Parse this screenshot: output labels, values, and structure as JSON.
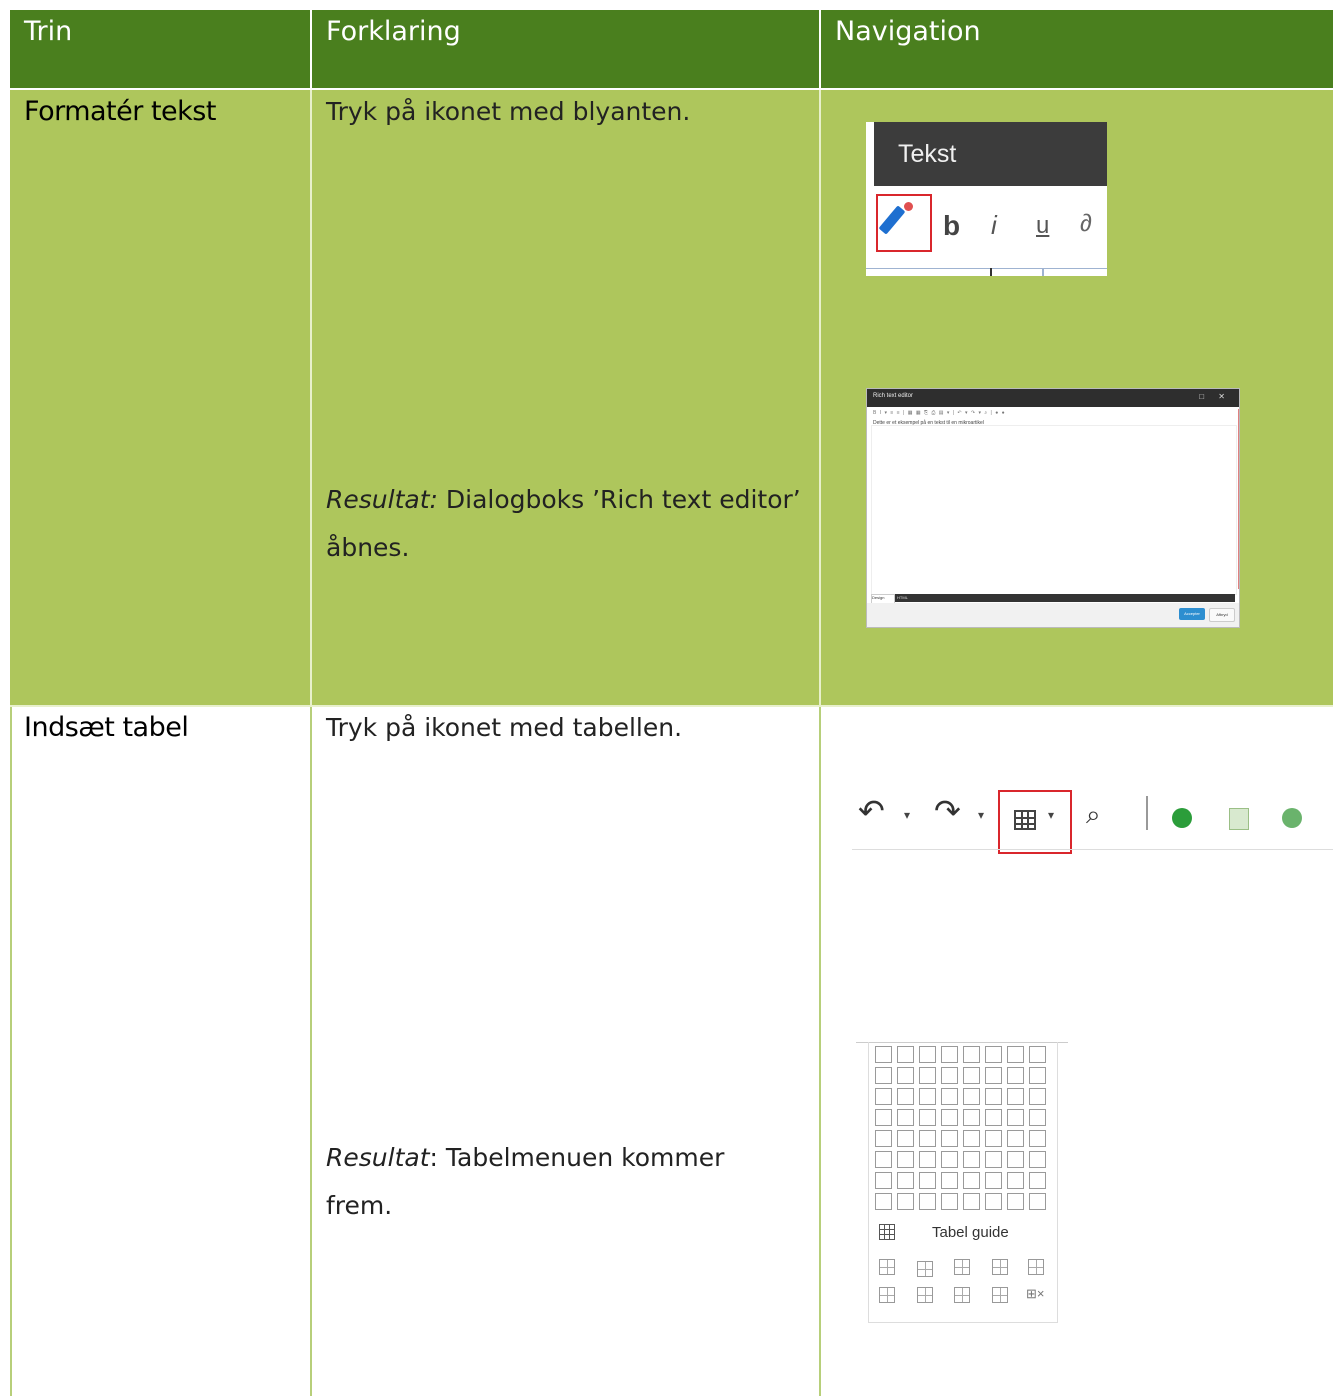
{
  "header": {
    "col1": "Trin",
    "col2": "Forklaring",
    "col3": "Navigation"
  },
  "rows": [
    {
      "step": "Formatér tekst",
      "instruction": "Tryk på ikonet med blyanten.",
      "result_label": "Resultat:",
      "result_text": " Dialogboks ’Rich text editor’",
      "result_text2": "åbnes.",
      "shot_toolbar_title": "Tekst",
      "shot_dialog": {
        "title": "Rich text editor",
        "body_text": "Dette er et eksempel på en tekst til en mikroartikel",
        "tab_design": "Design",
        "tab_html": "HTML",
        "accept": "Accepter",
        "cancel": "Afbryd"
      }
    },
    {
      "step": "Indsæt tabel",
      "instruction": "Tryk på ikonet med tabellen.",
      "result_label": "Resultat",
      "result_text": ": Tabelmenuen kommer",
      "result_text2": "frem.",
      "shot_menu_label": "Tabel guide"
    }
  ],
  "colors": {
    "header_bg": "#4a7f1e",
    "row_bg": "#aec65c",
    "highlight": "#d9262c"
  }
}
